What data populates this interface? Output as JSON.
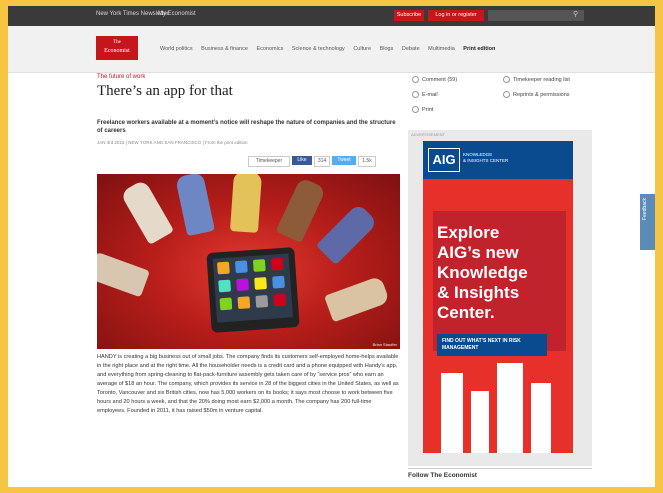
{
  "topbar": {
    "links": [
      "New York Times Newsletter",
      "My Economist"
    ],
    "subscribe": "Subscribe",
    "login": "Log in or register"
  },
  "masthead": {
    "logo_line1": "The",
    "logo_line2": "Economist"
  },
  "nav": {
    "items": [
      "World politics",
      "Business & finance",
      "Economics",
      "Science & technology",
      "Culture",
      "Blogs",
      "Debate",
      "Multimedia",
      "Print edition"
    ]
  },
  "article": {
    "kicker": "The future of work",
    "headline": "There’s an app for that",
    "rubric": "Freelance workers available at a moment’s notice will reshape the nature of companies and the structure of careers",
    "dateline": "JAN 3rd 2015 | NEW YORK AND SAN FRANCISCO | From the print edition",
    "share": {
      "timekeeper": "Timekeeper",
      "like": "Like",
      "count": "314",
      "tweet": "Tweet",
      "count2": "1.5k"
    },
    "image_credit": "Brian Stauffer",
    "body": "HANDY is creating a big business out of small jobs. The company finds its customers self-employed home-helps available in the right place and at the right time. All the householder needs is a credit card and a phone equipped with Handy’s app, and everything from spring-cleaning to flat-pack-furniture assembly gets taken care of by “service pros” who earn an average of $18 an hour. The company, which provides its service in 28 of the biggest cities in the United States, as well as Toronto, Vancouver and six British cities, now has 5,000 workers on its books; it says most choose to work between five hours and 20 hours a week, and that the 20% doing most earn $2,000 a month. The company has 200 full-time employees. Founded in 2011, it has raised $50m in venture capital."
  },
  "sidebar": {
    "links_left": [
      "Comment (59)",
      "E-mail",
      "Print"
    ],
    "links_right": [
      "Timekeeper reading list",
      "Reprints & permissions"
    ],
    "ad_label": "ADVERTISEMENT"
  },
  "ad": {
    "brand": "AIG",
    "brand_line1": "KNOWLEDGE",
    "brand_line2": "& INSIGHTS CENTER",
    "headline_lines": [
      "Explore",
      "AIG’s new",
      "Knowledge",
      "& Insights",
      "Center."
    ],
    "cta": "FIND OUT WHAT’S NEXT IN RISK MANAGEMENT"
  },
  "follow": "Follow The Economist",
  "feedback": "Feedback",
  "colors": {
    "background": "#f6c542",
    "brand_red": "#c4161c",
    "aig_blue": "#0a4b8f",
    "ad_red": "#e8302b"
  }
}
